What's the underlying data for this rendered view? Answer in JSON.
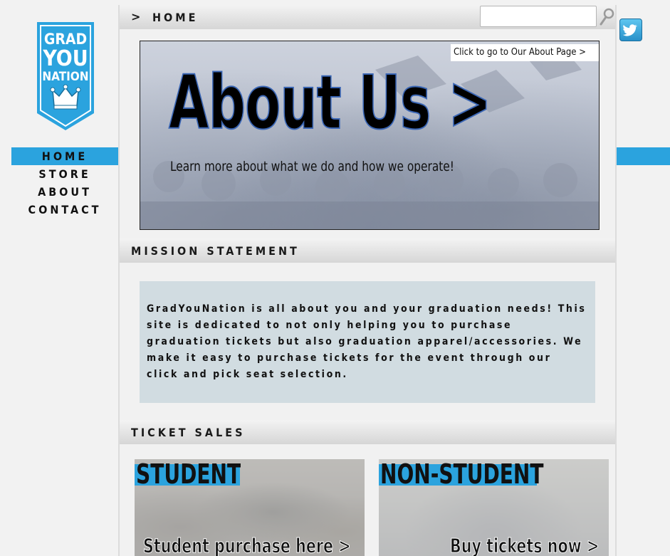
{
  "logo": {
    "line1": "GRAD",
    "line2": "YOU",
    "line3": "NATION"
  },
  "nav": {
    "items": [
      "HOME",
      "STORE",
      "ABOUT",
      "CONTACT"
    ],
    "active": "HOME"
  },
  "breadcrumb": {
    "chevron": ">",
    "title": "HOME"
  },
  "search": {
    "value": "",
    "placeholder": ""
  },
  "icons": {
    "search": "search-icon",
    "twitter": "twitter-icon"
  },
  "banner": {
    "link": "Click to go to Our About Page >",
    "heading": "About Us >",
    "subheading": "Learn more about what we do and how we operate!"
  },
  "mission": {
    "title": "MISSION STATEMENT",
    "text": "GradYouNation is all about you and your graduation needs! This site is dedicated to not only helping you to purchase graduation tickets but also graduation apparel/accessories. We make it easy to purchase tickets for the event through our click and pick seat selection."
  },
  "tickets": {
    "title": "TICKET SALES",
    "student": {
      "label": "STUDENT",
      "cta": "Student purchase here >"
    },
    "nonstudent": {
      "label": "NON-STUDENT",
      "cta": "Buy tickets now >"
    }
  },
  "colors": {
    "accent": "#2ba3de",
    "mission_bg": "#d1dce1",
    "heading_outline": "#3a66b5"
  }
}
